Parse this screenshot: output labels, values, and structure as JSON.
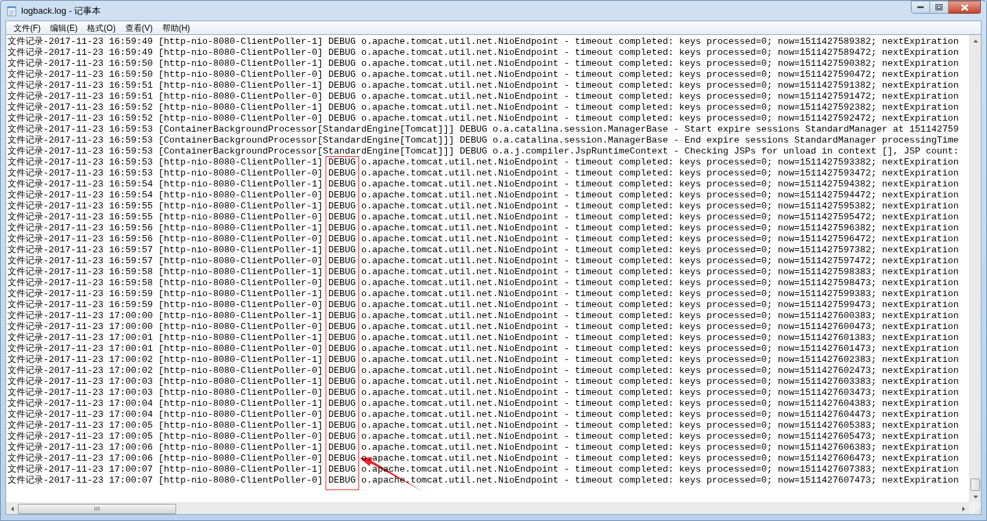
{
  "window": {
    "title": "logback.log - 记事本"
  },
  "menu": [
    "文件(F)",
    "编辑(E)",
    "格式(O)",
    "查看(V)",
    "帮助(H)"
  ],
  "lines": [
    "文件记录-2017-11-23 16:59:49 [http-nio-8080-ClientPoller-1] DEBUG o.apache.tomcat.util.net.NioEndpoint - timeout completed: keys processed=0; now=1511427589382; nextExpiration",
    "文件记录-2017-11-23 16:59:49 [http-nio-8080-ClientPoller-0] DEBUG o.apache.tomcat.util.net.NioEndpoint - timeout completed: keys processed=0; now=1511427589472; nextExpiration",
    "文件记录-2017-11-23 16:59:50 [http-nio-8080-ClientPoller-1] DEBUG o.apache.tomcat.util.net.NioEndpoint - timeout completed: keys processed=0; now=1511427590382; nextExpiration",
    "文件记录-2017-11-23 16:59:50 [http-nio-8080-ClientPoller-0] DEBUG o.apache.tomcat.util.net.NioEndpoint - timeout completed: keys processed=0; now=1511427590472; nextExpiration",
    "文件记录-2017-11-23 16:59:51 [http-nio-8080-ClientPoller-1] DEBUG o.apache.tomcat.util.net.NioEndpoint - timeout completed: keys processed=0; now=1511427591382; nextExpiration",
    "文件记录-2017-11-23 16:59:51 [http-nio-8080-ClientPoller-0] DEBUG o.apache.tomcat.util.net.NioEndpoint - timeout completed: keys processed=0; now=1511427591472; nextExpiration",
    "文件记录-2017-11-23 16:59:52 [http-nio-8080-ClientPoller-1] DEBUG o.apache.tomcat.util.net.NioEndpoint - timeout completed: keys processed=0; now=1511427592382; nextExpiration",
    "文件记录-2017-11-23 16:59:52 [http-nio-8080-ClientPoller-0] DEBUG o.apache.tomcat.util.net.NioEndpoint - timeout completed: keys processed=0; now=1511427592472; nextExpiration",
    "文件记录-2017-11-23 16:59:53 [ContainerBackgroundProcessor[StandardEngine[Tomcat]]] DEBUG o.a.catalina.session.ManagerBase - Start expire sessions StandardManager at 151142759",
    "文件记录-2017-11-23 16:59:53 [ContainerBackgroundProcessor[StandardEngine[Tomcat]]] DEBUG o.a.catalina.session.ManagerBase - End expire sessions StandardManager processingTime",
    "文件记录-2017-11-23 16:59:53 [ContainerBackgroundProcessor[StandardEngine[Tomcat]]] DEBUG o.a.j.compiler.JspRuntimeContext - Checking JSPs for unload in context [], JSP count:",
    "文件记录-2017-11-23 16:59:53 [http-nio-8080-ClientPoller-1] DEBUG o.apache.tomcat.util.net.NioEndpoint - timeout completed: keys processed=0; now=1511427593382; nextExpiration",
    "文件记录-2017-11-23 16:59:53 [http-nio-8080-ClientPoller-0] DEBUG o.apache.tomcat.util.net.NioEndpoint - timeout completed: keys processed=0; now=1511427593472; nextExpiration",
    "文件记录-2017-11-23 16:59:54 [http-nio-8080-ClientPoller-1] DEBUG o.apache.tomcat.util.net.NioEndpoint - timeout completed: keys processed=0; now=1511427594382; nextExpiration",
    "文件记录-2017-11-23 16:59:54 [http-nio-8080-ClientPoller-0] DEBUG o.apache.tomcat.util.net.NioEndpoint - timeout completed: keys processed=0; now=1511427594472; nextExpiration",
    "文件记录-2017-11-23 16:59:55 [http-nio-8080-ClientPoller-1] DEBUG o.apache.tomcat.util.net.NioEndpoint - timeout completed: keys processed=0; now=1511427595382; nextExpiration",
    "文件记录-2017-11-23 16:59:55 [http-nio-8080-ClientPoller-0] DEBUG o.apache.tomcat.util.net.NioEndpoint - timeout completed: keys processed=0; now=1511427595472; nextExpiration",
    "文件记录-2017-11-23 16:59:56 [http-nio-8080-ClientPoller-1] DEBUG o.apache.tomcat.util.net.NioEndpoint - timeout completed: keys processed=0; now=1511427596382; nextExpiration",
    "文件记录-2017-11-23 16:59:56 [http-nio-8080-ClientPoller-0] DEBUG o.apache.tomcat.util.net.NioEndpoint - timeout completed: keys processed=0; now=1511427596472; nextExpiration",
    "文件记录-2017-11-23 16:59:57 [http-nio-8080-ClientPoller-1] DEBUG o.apache.tomcat.util.net.NioEndpoint - timeout completed: keys processed=0; now=1511427597382; nextExpiration",
    "文件记录-2017-11-23 16:59:57 [http-nio-8080-ClientPoller-0] DEBUG o.apache.tomcat.util.net.NioEndpoint - timeout completed: keys processed=0; now=1511427597472; nextExpiration",
    "文件记录-2017-11-23 16:59:58 [http-nio-8080-ClientPoller-1] DEBUG o.apache.tomcat.util.net.NioEndpoint - timeout completed: keys processed=0; now=1511427598383; nextExpiration",
    "文件记录-2017-11-23 16:59:58 [http-nio-8080-ClientPoller-0] DEBUG o.apache.tomcat.util.net.NioEndpoint - timeout completed: keys processed=0; now=1511427598473; nextExpiration",
    "文件记录-2017-11-23 16:59:59 [http-nio-8080-ClientPoller-1] DEBUG o.apache.tomcat.util.net.NioEndpoint - timeout completed: keys processed=0; now=1511427599383; nextExpiration",
    "文件记录-2017-11-23 16:59:59 [http-nio-8080-ClientPoller-0] DEBUG o.apache.tomcat.util.net.NioEndpoint - timeout completed: keys processed=0; now=1511427599473; nextExpiration",
    "文件记录-2017-11-23 17:00:00 [http-nio-8080-ClientPoller-1] DEBUG o.apache.tomcat.util.net.NioEndpoint - timeout completed: keys processed=0; now=1511427600383; nextExpiration",
    "文件记录-2017-11-23 17:00:00 [http-nio-8080-ClientPoller-0] DEBUG o.apache.tomcat.util.net.NioEndpoint - timeout completed: keys processed=0; now=1511427600473; nextExpiration",
    "文件记录-2017-11-23 17:00:01 [http-nio-8080-ClientPoller-1] DEBUG o.apache.tomcat.util.net.NioEndpoint - timeout completed: keys processed=0; now=1511427601383; nextExpiration",
    "文件记录-2017-11-23 17:00:01 [http-nio-8080-ClientPoller-0] DEBUG o.apache.tomcat.util.net.NioEndpoint - timeout completed: keys processed=0; now=1511427601473; nextExpiration",
    "文件记录-2017-11-23 17:00:02 [http-nio-8080-ClientPoller-1] DEBUG o.apache.tomcat.util.net.NioEndpoint - timeout completed: keys processed=0; now=1511427602383; nextExpiration",
    "文件记录-2017-11-23 17:00:02 [http-nio-8080-ClientPoller-0] DEBUG o.apache.tomcat.util.net.NioEndpoint - timeout completed: keys processed=0; now=1511427602473; nextExpiration",
    "文件记录-2017-11-23 17:00:03 [http-nio-8080-ClientPoller-1] DEBUG o.apache.tomcat.util.net.NioEndpoint - timeout completed: keys processed=0; now=1511427603383; nextExpiration",
    "文件记录-2017-11-23 17:00:03 [http-nio-8080-ClientPoller-0] DEBUG o.apache.tomcat.util.net.NioEndpoint - timeout completed: keys processed=0; now=1511427603473; nextExpiration",
    "文件记录-2017-11-23 17:00:04 [http-nio-8080-ClientPoller-1] DEBUG o.apache.tomcat.util.net.NioEndpoint - timeout completed: keys processed=0; now=1511427604383; nextExpiration",
    "文件记录-2017-11-23 17:00:04 [http-nio-8080-ClientPoller-0] DEBUG o.apache.tomcat.util.net.NioEndpoint - timeout completed: keys processed=0; now=1511427604473; nextExpiration",
    "文件记录-2017-11-23 17:00:05 [http-nio-8080-ClientPoller-1] DEBUG o.apache.tomcat.util.net.NioEndpoint - timeout completed: keys processed=0; now=1511427605383; nextExpiration",
    "文件记录-2017-11-23 17:00:05 [http-nio-8080-ClientPoller-0] DEBUG o.apache.tomcat.util.net.NioEndpoint - timeout completed: keys processed=0; now=1511427605473; nextExpiration",
    "文件记录-2017-11-23 17:00:06 [http-nio-8080-ClientPoller-1] DEBUG o.apache.tomcat.util.net.NioEndpoint - timeout completed: keys processed=0; now=1511427606383; nextExpiration",
    "文件记录-2017-11-23 17:00:06 [http-nio-8080-ClientPoller-0] DEBUG o.apache.tomcat.util.net.NioEndpoint - timeout completed: keys processed=0; now=1511427606473; nextExpiration",
    "文件记录-2017-11-23 17:00:07 [http-nio-8080-ClientPoller-1] DEBUG o.apache.tomcat.util.net.NioEndpoint - timeout completed: keys processed=0; now=1511427607383; nextExpiration",
    "文件记录-2017-11-23 17:00:07 [http-nio-8080-ClientPoller-0] DEBUG o.apache.tomcat.util.net.NioEndpoint - timeout completed: keys processed=0; now=1511427607473; nextExpiration"
  ]
}
